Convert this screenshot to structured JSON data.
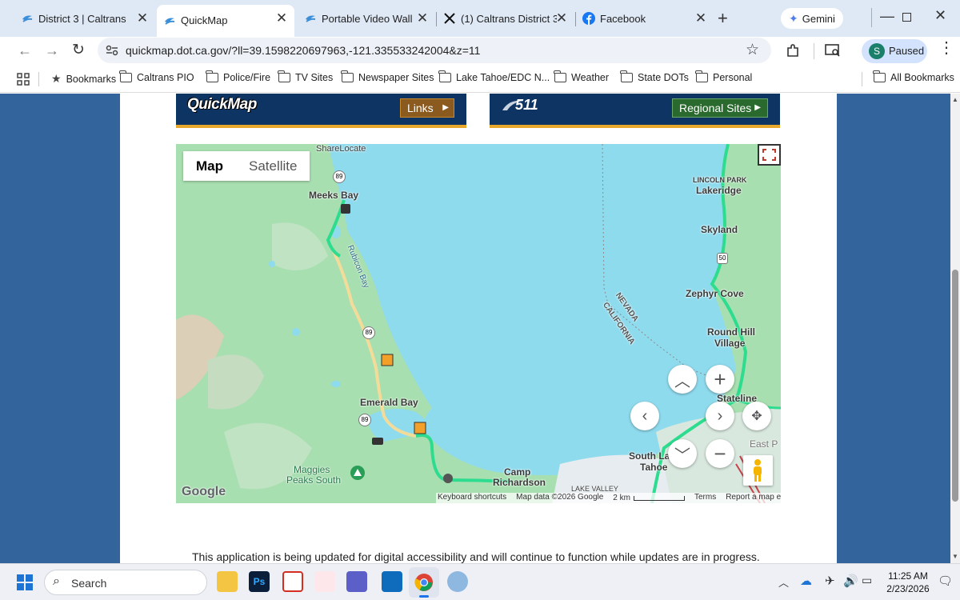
{
  "browser": {
    "tabs": [
      {
        "title": "District 3 | Caltrans",
        "icon": "caltrans-icon"
      },
      {
        "title": "QuickMap",
        "icon": "caltrans-icon",
        "active": true
      },
      {
        "title": "Portable Video Wall",
        "icon": "caltrans-icon"
      },
      {
        "title": "(1) Caltrans District 3",
        "icon": "x-icon"
      },
      {
        "title": "Facebook",
        "icon": "facebook-icon"
      }
    ],
    "gemini_label": "Gemini",
    "url": "quickmap.dot.ca.gov/?ll=39.1598220697963,-121.335533242004&z=11",
    "profile_initial": "S",
    "profile_status": "Paused",
    "bookmarks": [
      {
        "label": "Bookmarks",
        "icon": "star-icon"
      },
      {
        "label": "Caltrans PIO",
        "icon": "folder-icon"
      },
      {
        "label": "Police/Fire",
        "icon": "folder-icon"
      },
      {
        "label": "TV Sites",
        "icon": "folder-icon"
      },
      {
        "label": "Newspaper Sites",
        "icon": "folder-icon"
      },
      {
        "label": "Lake Tahoe/EDC N...",
        "icon": "folder-icon"
      },
      {
        "label": "Weather",
        "icon": "folder-icon"
      },
      {
        "label": "State DOTs",
        "icon": "folder-icon"
      },
      {
        "label": "Personal",
        "icon": "folder-icon"
      }
    ],
    "all_bookmarks": "All Bookmarks"
  },
  "page": {
    "quickmap_logo": "QuickMap",
    "links_button": "Links",
    "logo_511": "511",
    "regional_sites_button": "Regional Sites",
    "notice": "This application is being updated for digital accessibility and will continue to function while updates are in progress."
  },
  "map": {
    "type_map": "Map",
    "type_satellite": "Satellite",
    "labels": {
      "sharelocate": "ShareLocate",
      "meeks_bay": "Meeks Bay",
      "rubicon_bay": "Rubicon Bay",
      "lincoln_park": "LINCOLN PARK",
      "lakeridge": "Lakeridge",
      "skyland": "Skyland",
      "zephyr_cove": "Zephyr Cove",
      "nevada": "NEVADA",
      "california": "CALIFORNIA",
      "round_hill_1": "Round Hill",
      "round_hill_2": "Village",
      "stateline": "Stateline",
      "emerald_bay": "Emerald Bay",
      "east_p": "East P",
      "south_lake_1": "South La",
      "south_lake_2": "Tahoe",
      "maggies_1": "Maggies",
      "maggies_2": "Peaks South",
      "camp_1": "Camp",
      "camp_2": "Richardson",
      "lake_valley": "LAKE VALLEY"
    },
    "shields": {
      "route_89_a": "89",
      "route_89_b": "89",
      "route_89_c": "89",
      "route_50": "50"
    },
    "google_logo": "Google",
    "attribution": {
      "shortcuts": "Keyboard shortcuts",
      "data": "Map data ©2026 Google",
      "scale": "2 km",
      "terms": "Terms",
      "report": "Report a map error"
    },
    "colors": {
      "water": "#8fdbee",
      "land": "#a8dfb0",
      "road_green": "#2ddc8e",
      "road_yellow": "#f3dc9a"
    }
  },
  "taskbar": {
    "search_placeholder": "Search",
    "time": "11:25 AM",
    "date": "2/23/2026"
  }
}
